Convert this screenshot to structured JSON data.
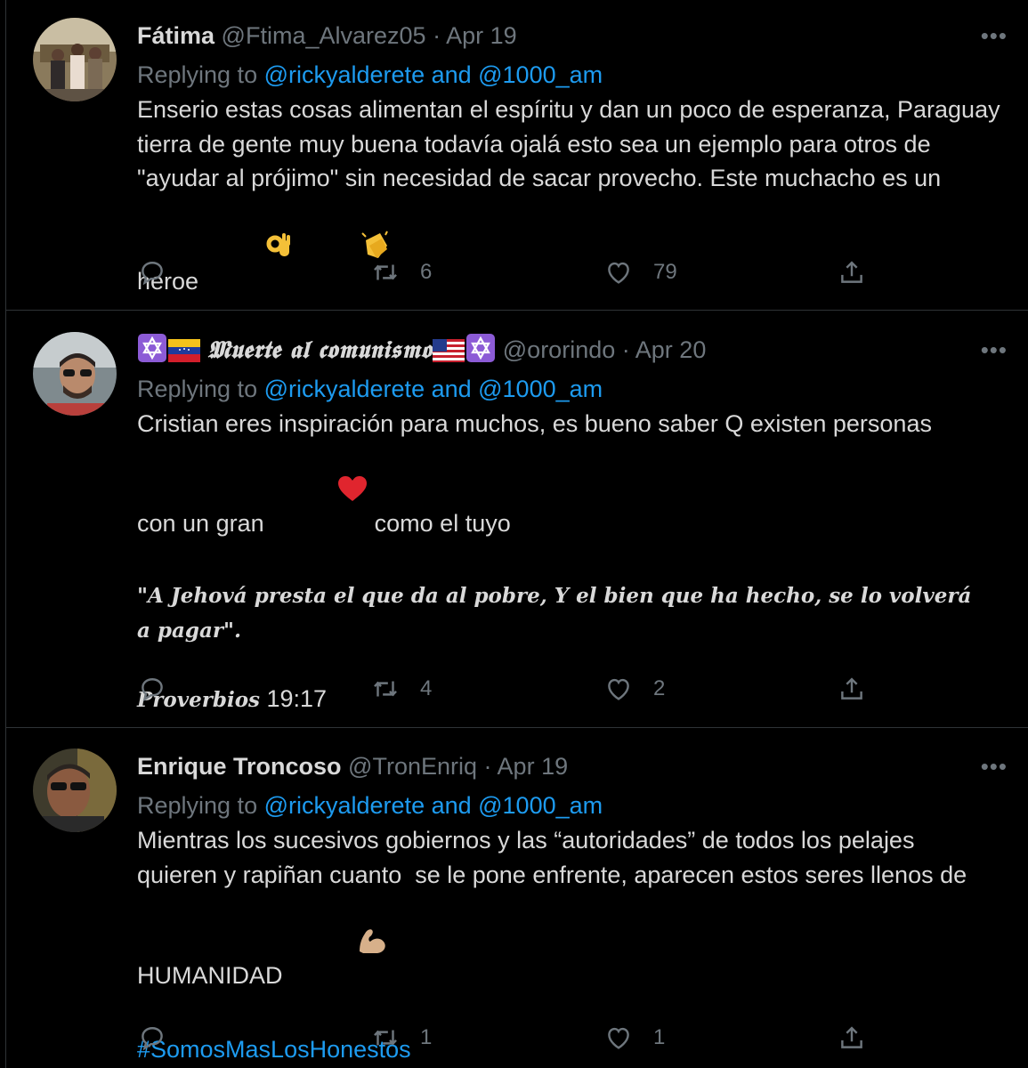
{
  "colors": {
    "background": "#000000",
    "text": "#d9d9d9",
    "secondary": "#6e767d",
    "accent": "#1d9bf0",
    "divider": "#2f3336"
  },
  "tweets": [
    {
      "name": "Fátima",
      "handle": "@Ftima_Alvarez05",
      "separator": "·",
      "date": "Apr 19",
      "more": "•••",
      "replying_prefix": "Replying to",
      "replying_to": "@rickyalderete and @1000_am",
      "text": "Enserio estas cosas alimentan el espíritu y dan un poco de esperanza, Paraguay tierra de gente muy buena todavía ojalá esto sea un ejemplo para otros de \"ayudar al prójimo\" sin necesidad de sacar provecho. Este muchacho es un heroe",
      "emojis": [
        "ok-hand-emoji",
        "clapping-hands-emoji"
      ],
      "reply_count": "",
      "retweet_count": "6",
      "like_count": "79"
    },
    {
      "name": "𝕸𝖚𝖊𝖗𝖙𝖊 𝖆𝖑 𝖈𝖔𝖒𝖚𝖓𝖎𝖘𝖒𝖔",
      "name_emojis_before": [
        "star-of-david-emoji",
        "venezuela-flag-emoji"
      ],
      "name_emojis_after": [
        "us-flag-emoji",
        "star-of-david-emoji"
      ],
      "handle": "@ororindo",
      "separator": "·",
      "date": "Apr 20",
      "more": "•••",
      "replying_prefix": "Replying to",
      "replying_to": "@rickyalderete and @1000_am",
      "text_1": "Cristian eres inspiración para muchos, es bueno saber Q existen personas con un gran",
      "text_heart": "red-heart-emoji",
      "text_2": "como el tuyo",
      "verse": "\"𝑨 𝑱𝒆𝒉𝒐𝒗á 𝒑𝒓𝒆𝒔𝒕𝒂 𝒆𝒍 𝒒𝒖𝒆 𝒅𝒂 𝒂𝒍 𝒑𝒐𝒃𝒓𝒆, 𝒀 𝒆𝒍 𝒃𝒊𝒆𝒏 𝒒𝒖𝒆 𝒉𝒂 𝒉𝒆𝒄𝒉𝒐, 𝒔𝒆 𝒍𝒐 𝒗𝒐𝒍𝒗𝒆𝒓á 𝒂 𝒑𝒂𝒈𝒂𝒓\".",
      "reference_book": "𝑷𝒓𝒐𝒗𝒆𝒓𝒃𝒊𝒐𝒔",
      "reference_verse": "19:17",
      "reply_count": "",
      "retweet_count": "4",
      "like_count": "2"
    },
    {
      "name": "Enrique Troncoso",
      "handle": "@TronEnriq",
      "separator": "·",
      "date": "Apr 19",
      "more": "•••",
      "replying_prefix": "Replying to",
      "replying_to": "@rickyalderete and @1000_am",
      "text": "Mientras los sucesivos gobiernos y las “autoridades” de todos los pelajes quieren y rapiñan cuanto  se le pone enfrente, aparecen estos seres llenos de HUMANIDAD",
      "emojis": [
        "flexed-biceps-emoji"
      ],
      "hashtag": "#SomosMasLosHonestos",
      "reply_count": "",
      "retweet_count": "1",
      "like_count": "1"
    }
  ]
}
